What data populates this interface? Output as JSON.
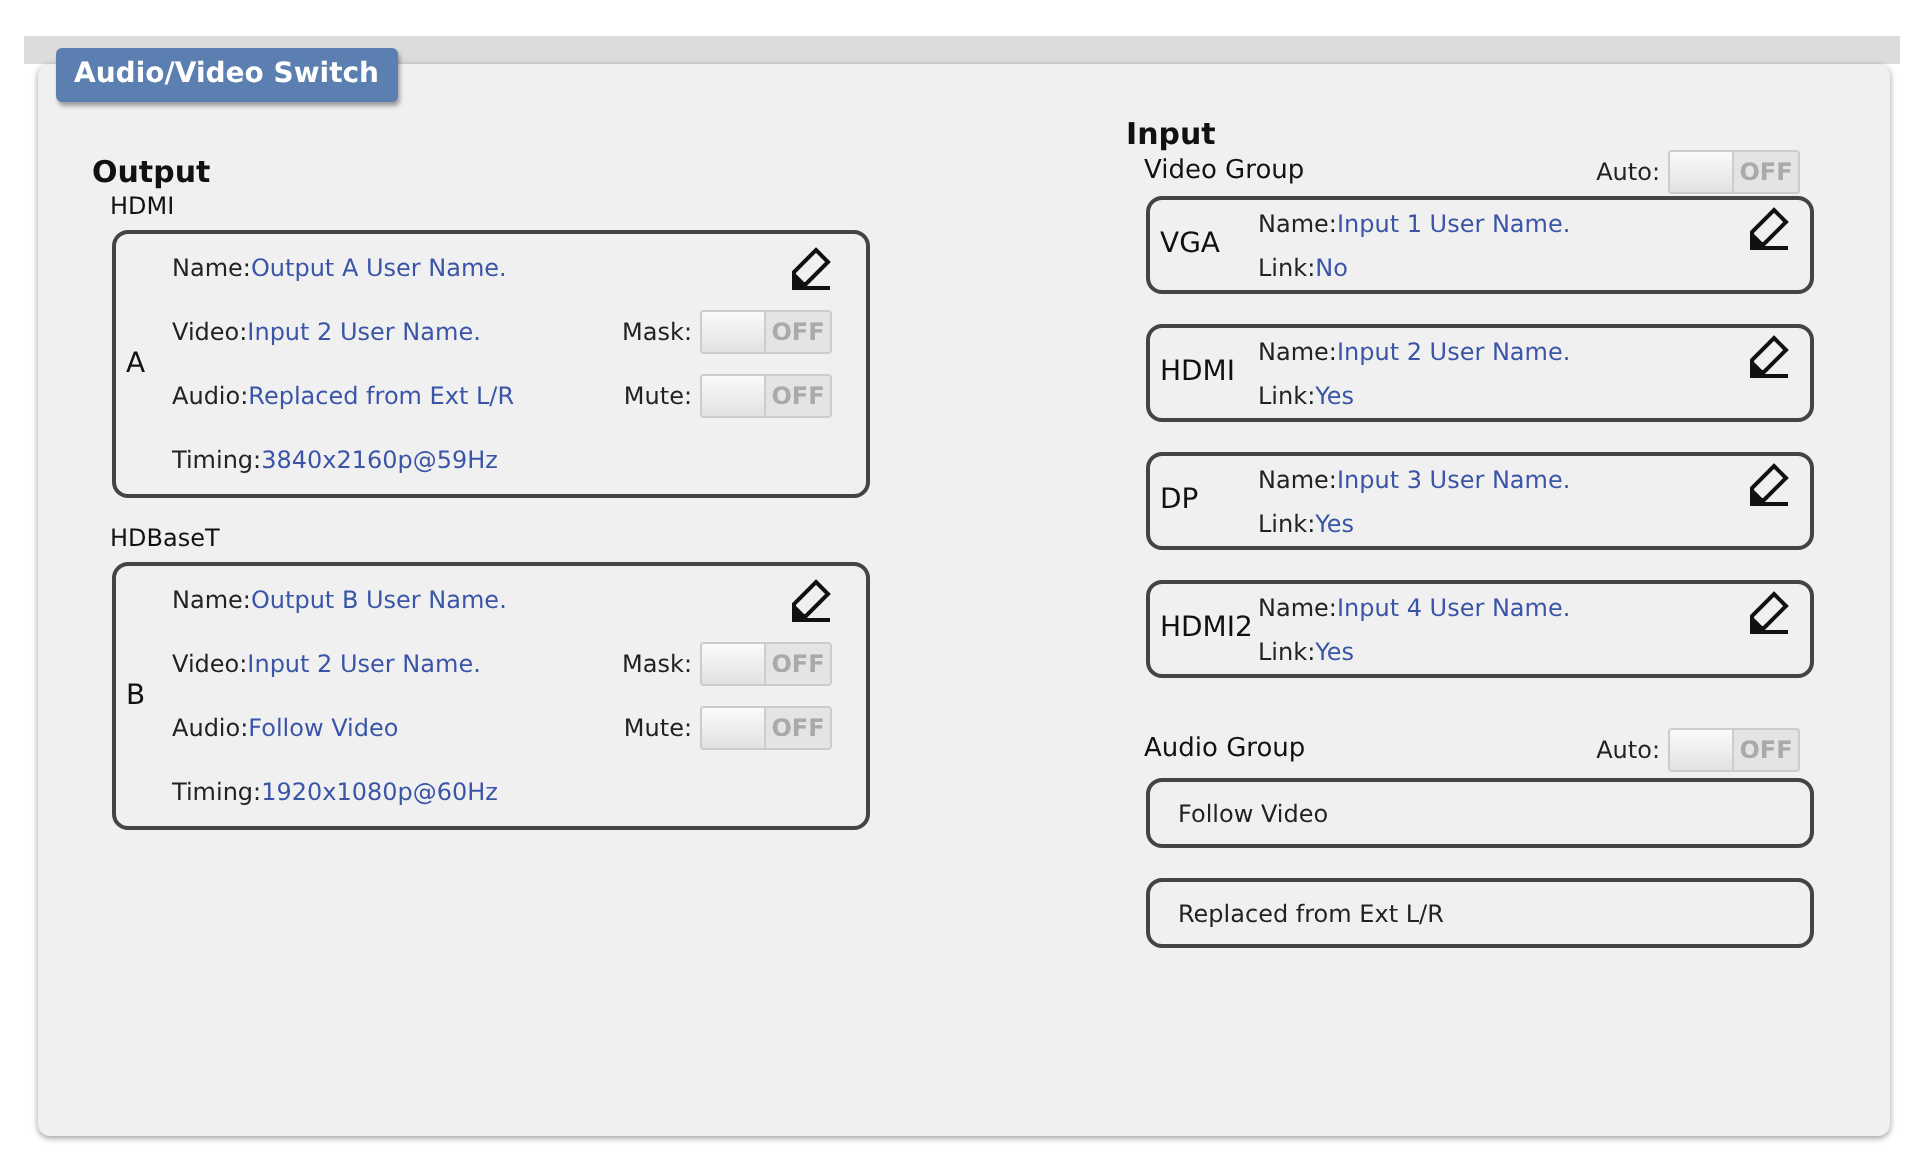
{
  "title": "Audio/Video Switch",
  "output": {
    "heading": "Output",
    "groups": [
      {
        "label": "HDMI",
        "letter": "A",
        "name_label": "Name:",
        "name": "Output A User Name.",
        "video_label": "Video:",
        "video": "Input 2 User Name.",
        "audio_label": "Audio:",
        "audio": "Replaced from Ext L/R",
        "timing_label": "Timing:",
        "timing": "3840x2160p@59Hz",
        "mask": {
          "label": "Mask:",
          "on": false,
          "state_text": "OFF"
        },
        "mute": {
          "label": "Mute:",
          "on": false,
          "state_text": "OFF"
        }
      },
      {
        "label": "HDBaseT",
        "letter": "B",
        "name_label": "Name:",
        "name": "Output B User Name.",
        "video_label": "Video:",
        "video": "Input 2 User Name.",
        "audio_label": "Audio:",
        "audio": "Follow Video",
        "timing_label": "Timing:",
        "timing": "1920x1080p@60Hz",
        "mask": {
          "label": "Mask:",
          "on": false,
          "state_text": "OFF"
        },
        "mute": {
          "label": "Mute:",
          "on": false,
          "state_text": "OFF"
        }
      }
    ]
  },
  "input": {
    "heading": "Input",
    "video_group": {
      "label": "Video Group",
      "auto": {
        "label": "Auto:",
        "on": false,
        "state_text": "OFF"
      },
      "inputs": [
        {
          "port": "VGA",
          "name_label": "Name:",
          "name": "Input 1 User Name.",
          "link_label": "Link:",
          "link": "No"
        },
        {
          "port": "HDMI",
          "name_label": "Name:",
          "name": "Input 2 User Name.",
          "link_label": "Link:",
          "link": "Yes"
        },
        {
          "port": "DP",
          "name_label": "Name:",
          "name": "Input 3 User Name.",
          "link_label": "Link:",
          "link": "Yes"
        },
        {
          "port": "HDMI2",
          "name_label": "Name:",
          "name": "Input 4 User Name.",
          "link_label": "Link:",
          "link": "Yes"
        }
      ]
    },
    "audio_group": {
      "label": "Audio Group",
      "auto": {
        "label": "Auto:",
        "on": false,
        "state_text": "OFF"
      },
      "options": [
        "Follow Video",
        "Replaced from Ext L/R"
      ]
    }
  }
}
